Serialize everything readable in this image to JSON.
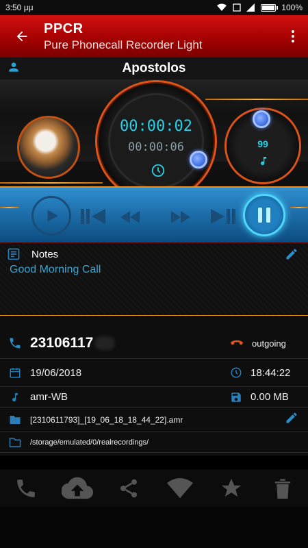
{
  "status": {
    "time": "3:50 μμ",
    "battery": "100%"
  },
  "appbar": {
    "title": "PPCR",
    "subtitle": "Pure Phonecall Recorder Light"
  },
  "contact": {
    "name": "Apostolos"
  },
  "player": {
    "elapsed": "00:00:02",
    "total": "00:00:06",
    "volume": "99"
  },
  "notes": {
    "label": "Notes",
    "text": "Good Morning Call"
  },
  "details": {
    "phone": "23106117",
    "direction": "outgoing",
    "date": "19/06/2018",
    "time": "18:44:22",
    "codec": "amr-WB",
    "size": "0.00 MB",
    "filename": "[2310611793]_[19_06_18_18_44_22].amr",
    "path": "/storage/emulated/0/realrecordings/"
  },
  "colors": {
    "accent": "#2ad0e8",
    "appbar": "#b00000",
    "ring": "#e0531a",
    "blue": "#1c6ca8"
  }
}
